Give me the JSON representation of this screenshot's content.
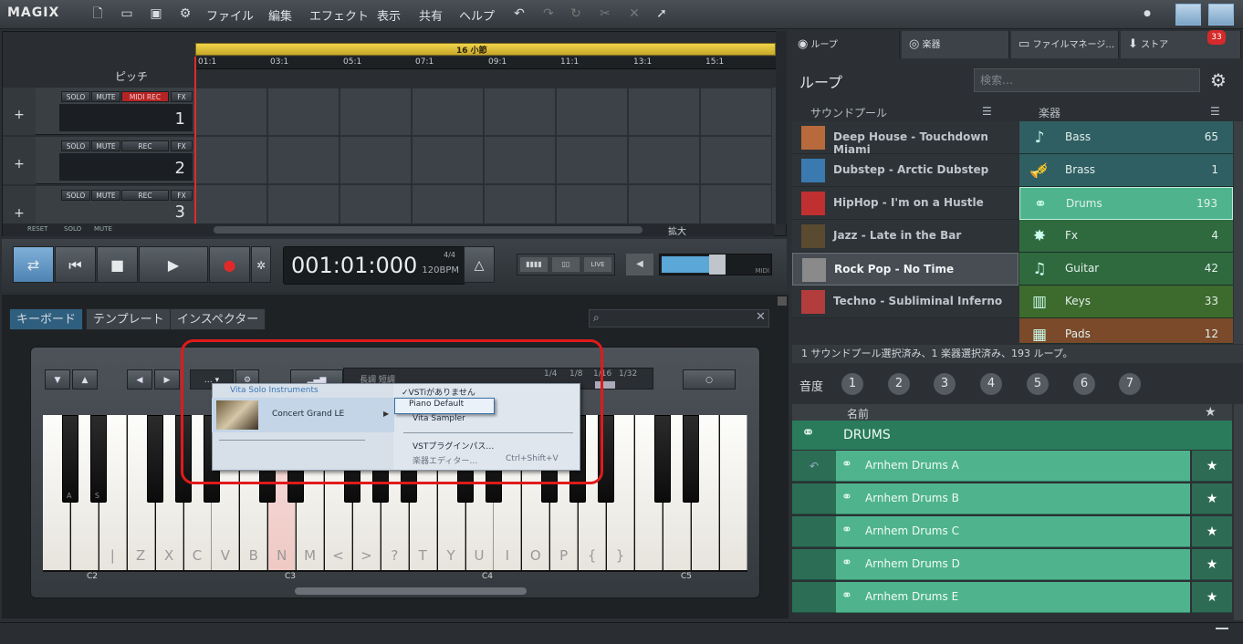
{
  "app": {
    "logo": "MAGIX"
  },
  "menu": [
    "ファイル",
    "編集",
    "エフェクト",
    "表示",
    "共有",
    "ヘルプ"
  ],
  "arranger": {
    "ruler_label": "16 小節",
    "bars": [
      "01:1",
      "03:1",
      "05:1",
      "07:1",
      "09:1",
      "11:1",
      "13:1",
      "15:1"
    ],
    "pitch_label": "ピッチ",
    "zoom_label": "拡大",
    "tracks": [
      {
        "solo": "SOLO",
        "mute": "MUTE",
        "rec": "MIDI REC",
        "fx": "FX",
        "num": "1"
      },
      {
        "solo": "SOLO",
        "mute": "MUTE",
        "rec": "REC",
        "fx": "FX",
        "num": "2"
      },
      {
        "solo": "SOLO",
        "mute": "MUTE",
        "rec": "REC",
        "fx": "FX",
        "num": "3"
      }
    ],
    "bottom": {
      "reset": "RESET",
      "solo": "SOLO",
      "mute": "MUTE"
    }
  },
  "transport": {
    "time": "001:01:000",
    "bpm": "120BPM",
    "sig": "4/4",
    "live": "LIVE",
    "midi": "MIDI"
  },
  "lower": {
    "tabs": [
      "キーボード",
      "テンプレート",
      "インスペクター"
    ]
  },
  "keyboard": {
    "mode_labels": "長調  短調",
    "quant": [
      "1/4",
      "1/8",
      "1/16",
      "1/32"
    ],
    "white_labels": [
      "",
      "",
      "",
      "",
      "",
      "",
      "",
      "",
      "",
      "",
      "|",
      "Z",
      "X",
      "C",
      "V",
      "B",
      "N",
      "M",
      "<",
      ">",
      "?",
      "T",
      "Y",
      "U",
      "I",
      "O",
      "P",
      "{",
      "}",
      "",
      "",
      "",
      "",
      "",
      "",
      "",
      "",
      "",
      "",
      ""
    ],
    "black_labels": [
      "A",
      "S"
    ],
    "octaves": [
      "C2",
      "C3",
      "C4",
      "C5"
    ]
  },
  "popup": {
    "header": "Vita Solo Instruments",
    "item": "Concert Grand LE",
    "vsti_none": "VSTiがありません",
    "piano_default": "Piano Default",
    "vita_sampler": "Vita Sampler",
    "vst_bypass": "VSTプラグインパス…",
    "editor": "楽器エディター…",
    "shortcut": "Ctrl+Shift+V"
  },
  "right": {
    "tabs": [
      "ループ",
      "楽器",
      "ファイルマネージ…",
      "ストア"
    ],
    "badge": "33",
    "title": "ループ",
    "search_placeholder": "検索…",
    "col_soundpool": "サウンドプール",
    "col_inst": "楽器",
    "soundpools": [
      {
        "name": "Deep House - Touchdown Miami",
        "color": "#b86a3c"
      },
      {
        "name": "Dubstep - Arctic Dubstep",
        "color": "#3a7ab0"
      },
      {
        "name": "HipHop - I'm on a Hustle",
        "color": "#c03030"
      },
      {
        "name": "Jazz - Late in the Bar",
        "color": "#5a4a30"
      },
      {
        "name": "Rock Pop - No Time",
        "color": "#8a8a8a"
      },
      {
        "name": "Techno - Subliminal Inferno",
        "color": "#b33c3c"
      }
    ],
    "instruments": [
      {
        "name": "Bass",
        "count": "65",
        "color": "#2f5f63",
        "icon": "bass-icon"
      },
      {
        "name": "Brass",
        "count": "1",
        "color": "#2f5f63",
        "icon": "trumpet-icon"
      },
      {
        "name": "Drums",
        "count": "193",
        "color": "#4fb48e",
        "icon": "drums-icon"
      },
      {
        "name": "Fx",
        "count": "4",
        "color": "#2f6a3e",
        "icon": "fx-icon"
      },
      {
        "name": "Guitar",
        "count": "42",
        "color": "#2f6a3e",
        "icon": "guitar-icon"
      },
      {
        "name": "Keys",
        "count": "33",
        "color": "#3d6a2d",
        "icon": "keys-icon"
      },
      {
        "name": "Pads",
        "count": "12",
        "color": "#7a4a2a",
        "icon": "pads-icon"
      }
    ],
    "status": "1 サウンドプール選択済み、1 楽器選択済み、193 ループ。",
    "pitch_label": "音度",
    "pitch_nums": [
      "1",
      "2",
      "3",
      "4",
      "5",
      "6",
      "7"
    ],
    "name_header": "名前",
    "group": "DRUMS",
    "loops": [
      "Arnhem Drums A",
      "Arnhem Drums B",
      "Arnhem Drums C",
      "Arnhem Drums D",
      "Arnhem Drums E"
    ]
  }
}
